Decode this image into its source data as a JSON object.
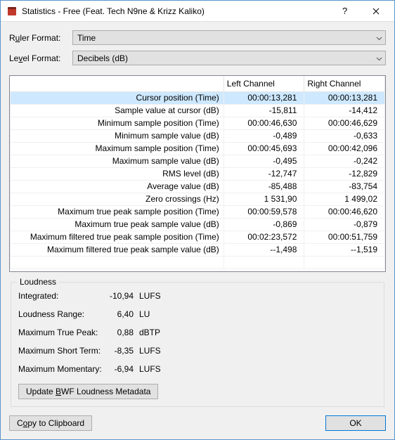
{
  "titlebar": {
    "title": "Statistics - Free (Feat. Tech N9ne & Krizz Kaliko)"
  },
  "form": {
    "ruler_label_pre": "R",
    "ruler_label_ul": "u",
    "ruler_label_post": "ler Format:",
    "ruler_value": "Time",
    "level_label_pre": "Le",
    "level_label_ul": "v",
    "level_label_post": "el Format:",
    "level_value": "Decibels (dB)"
  },
  "table": {
    "header_left": "Left Channel",
    "header_right": "Right Channel",
    "rows": [
      {
        "desc": "Cursor position (Time)",
        "l": "00:00:13,281",
        "r": "00:00:13,281"
      },
      {
        "desc": "Sample value at cursor (dB)",
        "l": "-15,811",
        "r": "-14,412"
      },
      {
        "desc": "Minimum sample position (Time)",
        "l": "00:00:46,630",
        "r": "00:00:46,629"
      },
      {
        "desc": "Minimum sample value (dB)",
        "l": "-0,489",
        "r": "-0,633"
      },
      {
        "desc": "Maximum sample position (Time)",
        "l": "00:00:45,693",
        "r": "00:00:42,096"
      },
      {
        "desc": "Maximum sample value (dB)",
        "l": "-0,495",
        "r": "-0,242"
      },
      {
        "desc": "RMS level (dB)",
        "l": "-12,747",
        "r": "-12,829"
      },
      {
        "desc": "Average value (dB)",
        "l": "-85,488",
        "r": "-83,754"
      },
      {
        "desc": "Zero crossings (Hz)",
        "l": "1 531,90",
        "r": "1 499,02"
      },
      {
        "desc": "Maximum true peak sample position (Time)",
        "l": "00:00:59,578",
        "r": "00:00:46,620"
      },
      {
        "desc": "Maximum true peak sample value (dB)",
        "l": "-0,869",
        "r": "-0,879"
      },
      {
        "desc": "Maximum filtered true peak sample position (Time)",
        "l": "00:02:23,572",
        "r": "00:00:51,759"
      },
      {
        "desc": "Maximum filtered true peak sample value (dB)",
        "l": "--1,498",
        "r": "--1,519"
      }
    ]
  },
  "loudness": {
    "title": "Loudness",
    "rows": [
      {
        "label": "Integrated:",
        "value": "-10,94",
        "unit": "LUFS"
      },
      {
        "label": "Loudness Range:",
        "value": "6,40",
        "unit": "LU"
      },
      {
        "label": "Maximum True Peak:",
        "value": "0,88",
        "unit": "dBTP"
      },
      {
        "label": "Maximum Short Term:",
        "value": "-8,35",
        "unit": "LUFS"
      },
      {
        "label": "Maximum Momentary:",
        "value": "-6,94",
        "unit": "LUFS"
      }
    ],
    "update_pre": "Update ",
    "update_ul": "B",
    "update_post": "WF Loudness Metadata"
  },
  "footer": {
    "copy_pre": "C",
    "copy_ul": "o",
    "copy_post": "py to Clipboard",
    "ok": "OK"
  }
}
